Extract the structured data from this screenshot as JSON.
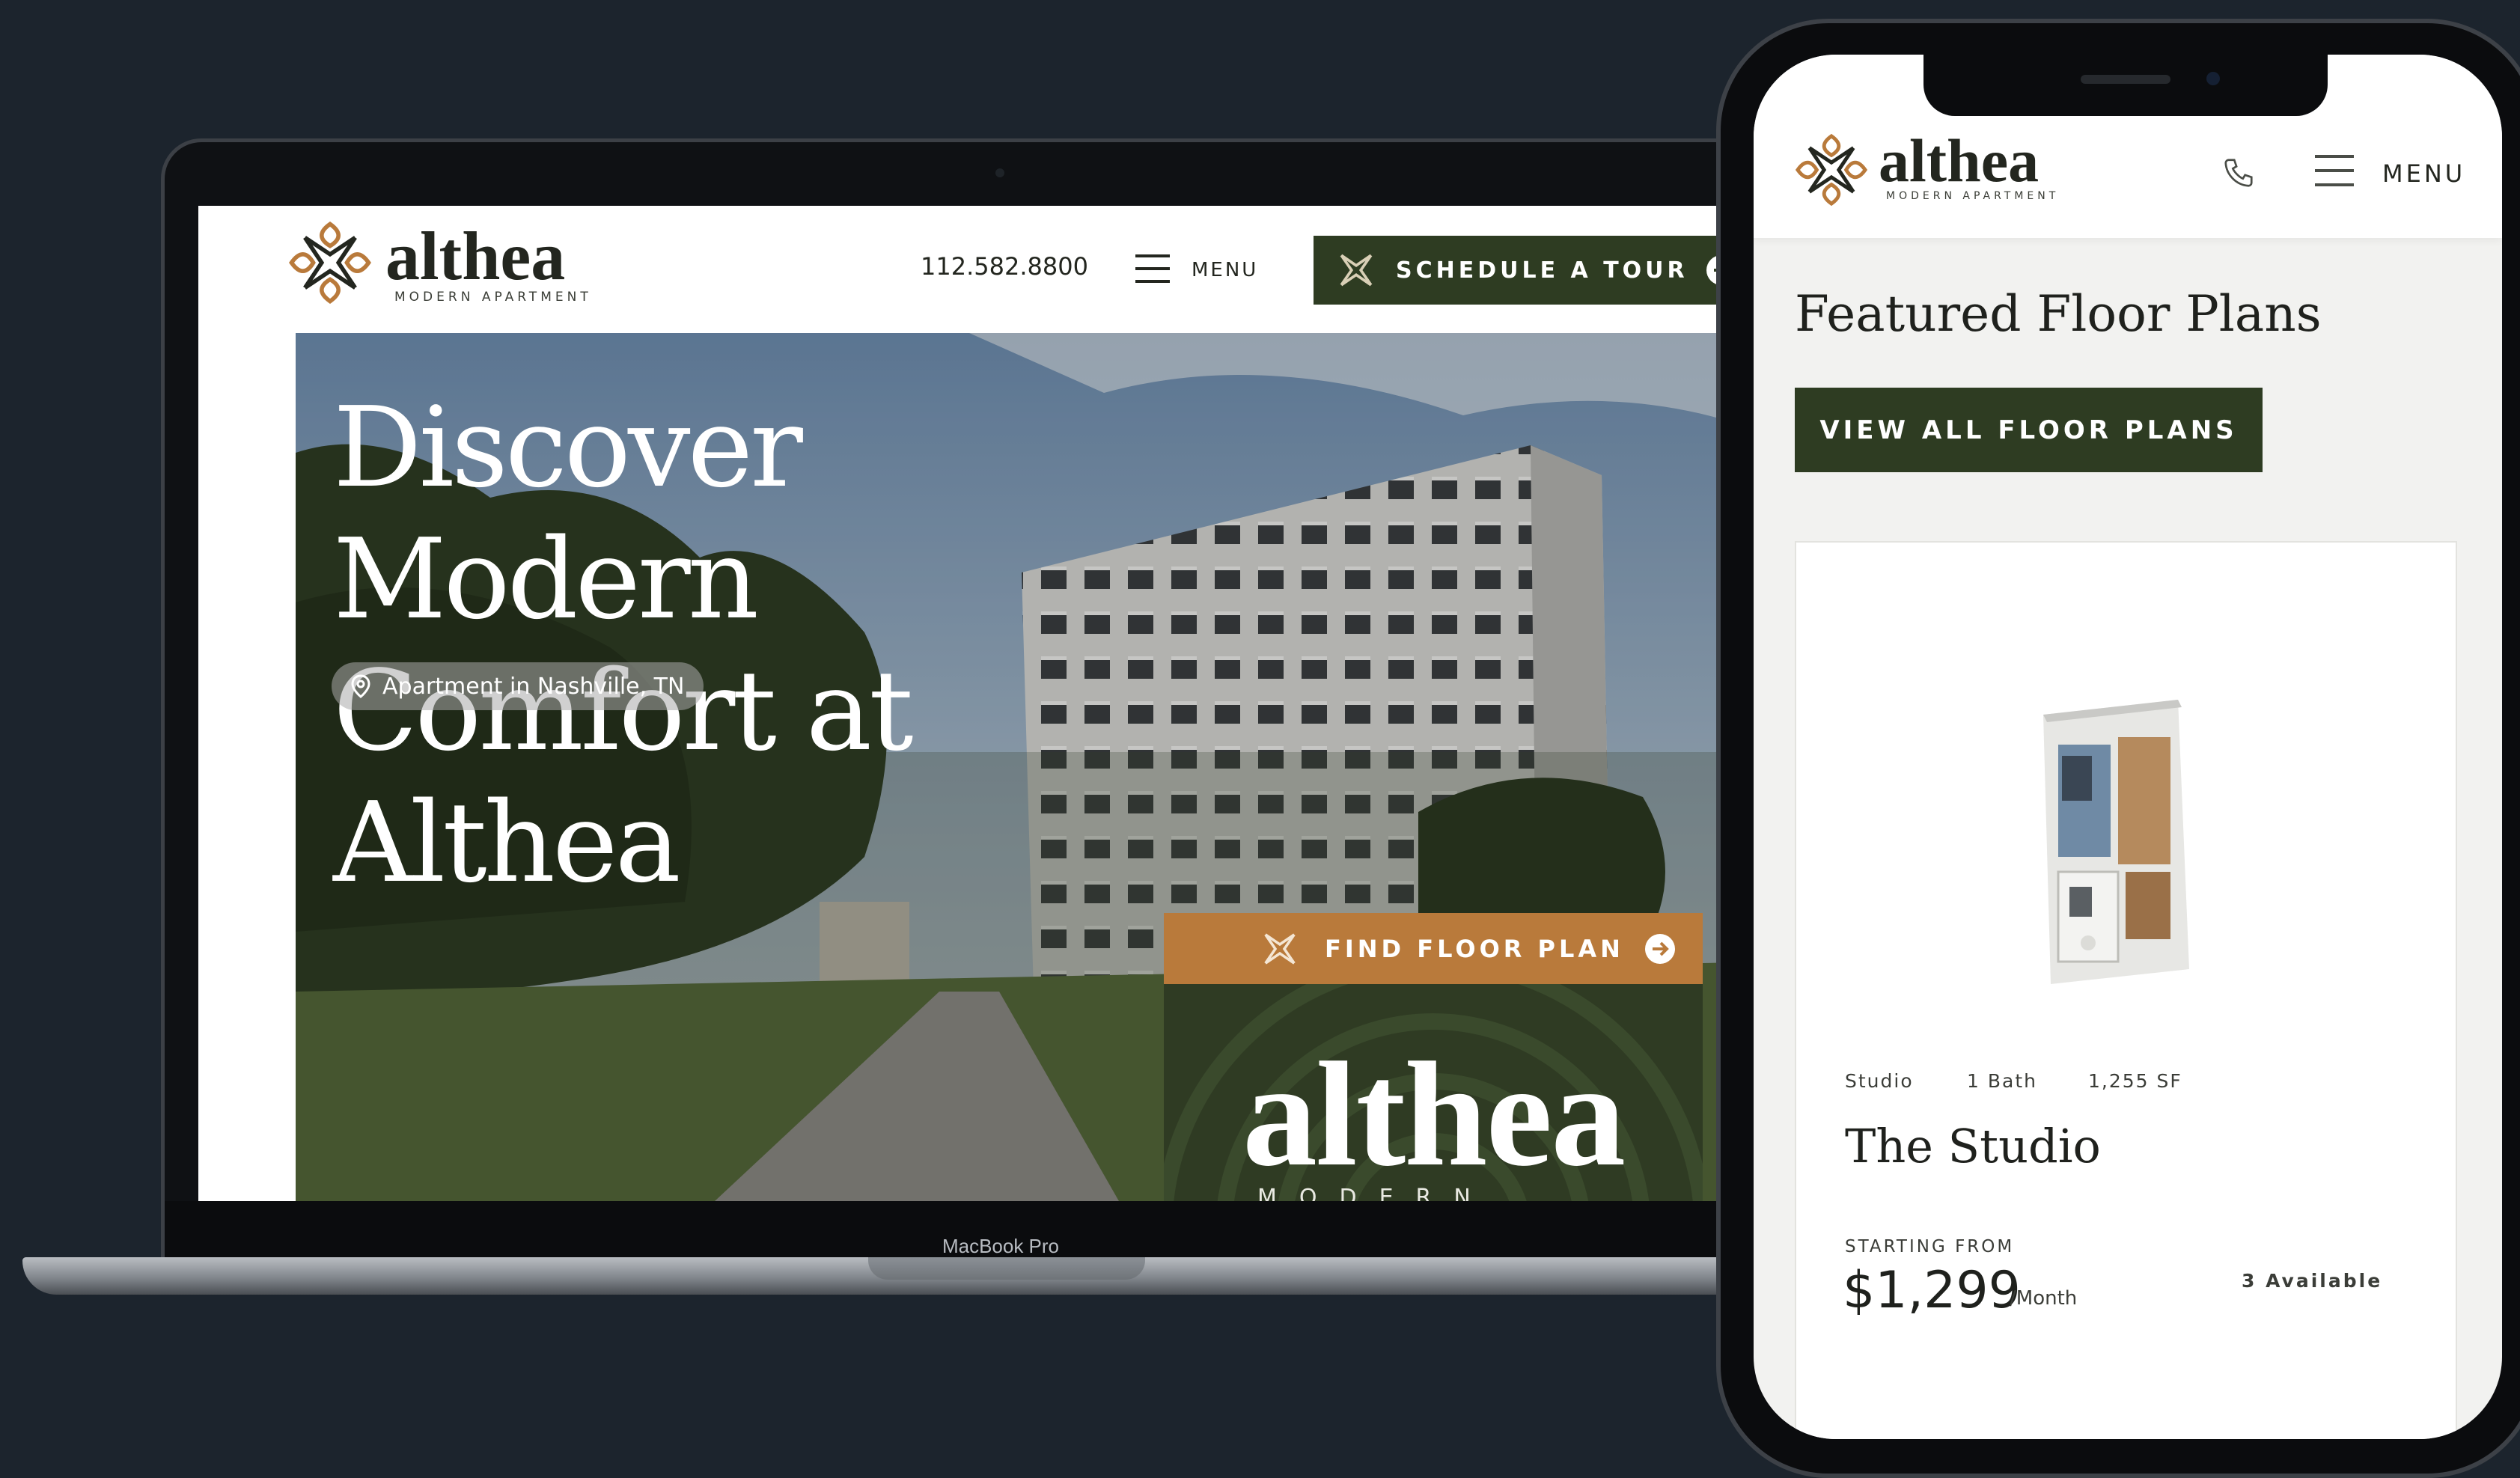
{
  "brand": {
    "name": "althea",
    "tagline": "MODERN APARTMENT",
    "colors": {
      "primary_green": "#2e3c22",
      "accent_copper": "#b97a3b",
      "ink": "#23261f",
      "background": "#1c242d"
    }
  },
  "laptop": {
    "model_label": "MacBook Pro",
    "header": {
      "phone": "112.582.8800",
      "menu_label": "MENU",
      "menu_icon": "hamburger-icon",
      "cta_label": "SCHEDULE A TOUR",
      "cta_icon": "arrow-right-circle-icon"
    },
    "hero": {
      "title_line1": "Discover Modern",
      "title_line2": "Comfort at Althea",
      "location": "Apartment in Nashville, TN",
      "location_icon": "map-pin-icon",
      "find_label": "FIND FLOOR PLAN",
      "panel_wordmark": "althea",
      "panel_tagline": "MODERN APARTMENT"
    }
  },
  "mobile": {
    "header": {
      "menu_label": "MENU",
      "phone_icon": "phone-icon",
      "menu_icon": "hamburger-icon"
    },
    "section_title": "Featured Floor Plans",
    "view_all_label": "VIEW ALL FLOOR PLANS",
    "card": {
      "specs": [
        "Studio",
        "1 Bath",
        "1,255 SF"
      ],
      "name": "The Studio",
      "starting_label": "STARTING FROM",
      "price": "$1,299",
      "price_unit": "/Month",
      "availability": "3 Available"
    }
  }
}
